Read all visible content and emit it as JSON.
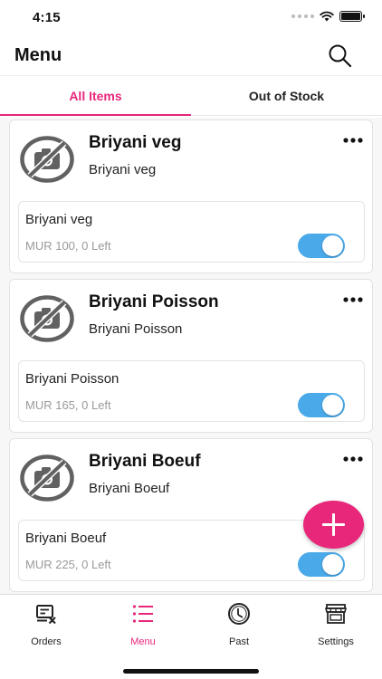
{
  "status_bar": {
    "time": "4:15"
  },
  "header": {
    "title": "Menu",
    "search_icon": "search-icon"
  },
  "tabs": [
    {
      "label": "All Items",
      "active": true
    },
    {
      "label": "Out of Stock",
      "active": false
    }
  ],
  "items": [
    {
      "title": "Briyani veg",
      "subtitle": "Briyani veg",
      "variant": {
        "name": "Briyani veg",
        "info": "MUR 100, 0 Left",
        "enabled": true
      }
    },
    {
      "title": "Briyani Poisson",
      "subtitle": "Briyani Poisson",
      "variant": {
        "name": "Briyani Poisson",
        "info": "MUR 165, 0 Left",
        "enabled": true
      }
    },
    {
      "title": "Briyani Boeuf",
      "subtitle": "Briyani Boeuf",
      "variant": {
        "name": "Briyani Boeuf",
        "info": "MUR 225, 0 Left",
        "enabled": true
      }
    }
  ],
  "fab": {
    "icon": "plus-icon"
  },
  "bottom_nav": [
    {
      "label": "Orders",
      "icon": "orders-icon",
      "active": false
    },
    {
      "label": "Menu",
      "icon": "menu-list-icon",
      "active": true
    },
    {
      "label": "Past",
      "icon": "clock-icon",
      "active": false
    },
    {
      "label": "Settings",
      "icon": "store-icon",
      "active": false
    }
  ],
  "colors": {
    "accent": "#e8267a",
    "toggle_on": "#4aa9e9",
    "muted_text": "#9a9a9a"
  }
}
